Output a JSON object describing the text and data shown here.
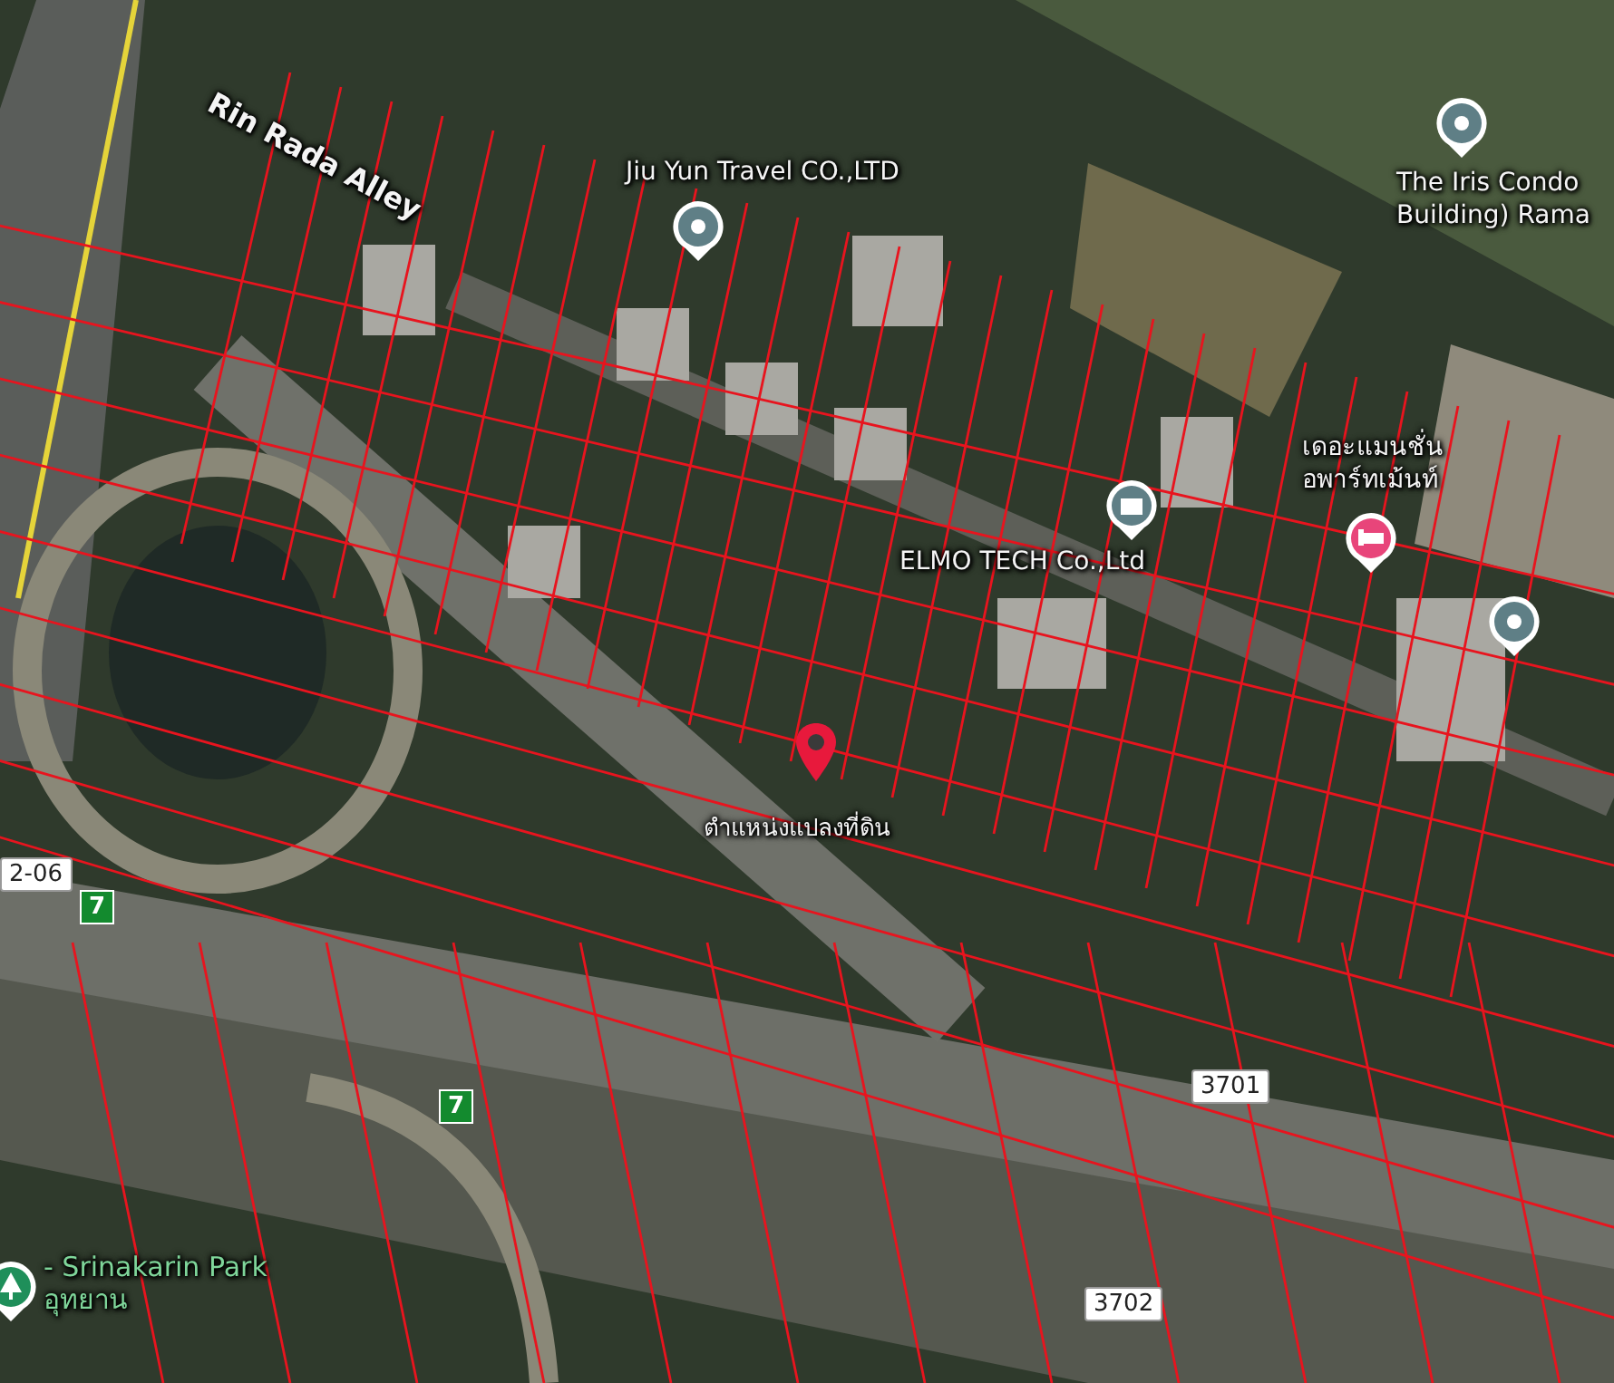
{
  "map": {
    "labels": [
      {
        "kind": "street",
        "lines": [
          "Rin Rada Alley"
        ]
      },
      {
        "kind": "place",
        "lines": [
          "Jiu Yun Travel CO.,LTD"
        ]
      },
      {
        "kind": "place",
        "lines": [
          "The Iris Condo",
          "Building) Rama"
        ]
      },
      {
        "kind": "place",
        "lines": [
          "เดอะแมนชั่น",
          "อพาร์ทเม้นท์"
        ]
      },
      {
        "kind": "place",
        "lines": [
          "ELMO TECH Co.,Ltd"
        ]
      },
      {
        "kind": "marker",
        "lines": [
          "ตำแหน่งแปลงที่ดิน"
        ]
      },
      {
        "kind": "park",
        "lines": [
          "- Srinakarin Park",
          "อุทยาน"
        ]
      },
      {
        "kind": "shield",
        "lines": [
          "3701"
        ]
      },
      {
        "kind": "shield",
        "lines": [
          "3702"
        ]
      },
      {
        "kind": "shield",
        "lines": [
          "2-06"
        ]
      },
      {
        "kind": "exit",
        "lines": [
          "7"
        ]
      },
      {
        "kind": "exit",
        "lines": [
          "7"
        ]
      }
    ],
    "pins": [
      {
        "kind": "poi",
        "color": "#5f7f86"
      },
      {
        "kind": "poi",
        "color": "#5f7f86"
      },
      {
        "kind": "poi",
        "color": "#5f7f86"
      },
      {
        "kind": "building",
        "color": "#5f7f86"
      },
      {
        "kind": "hotel",
        "color": "#e8457a"
      },
      {
        "kind": "park",
        "color": "#1f8f5a"
      },
      {
        "kind": "marker",
        "color": "#e8193c"
      }
    ]
  }
}
